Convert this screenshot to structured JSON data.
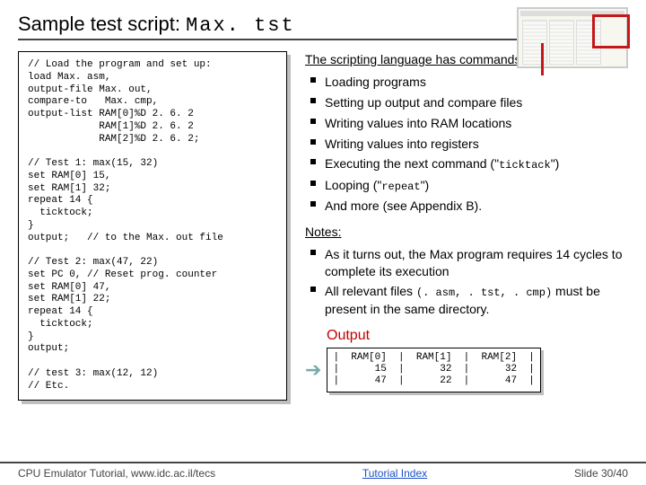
{
  "title_prefix": "Sample test script: ",
  "title_mono": "Max. tst",
  "code": "// Load the program and set up:\nload Max. asm,\noutput-file Max. out,\ncompare-to   Max. cmp,\noutput-list RAM[0]%D 2. 6. 2\n            RAM[1]%D 2. 6. 2\n            RAM[2]%D 2. 6. 2;\n\n// Test 1: max(15, 32)\nset RAM[0] 15,\nset RAM[1] 32;\nrepeat 14 {\n  ticktock;\n}\noutput;   // to the Max. out file\n\n// Test 2: max(47, 22)\nset PC 0, // Reset prog. counter\nset RAM[0] 47,\nset RAM[1] 22;\nrepeat 14 {\n  ticktock;\n}\noutput;\n\n// test 3: max(12, 12)\n// Etc.",
  "heading1": "The scripting language has commands for:",
  "bul": {
    "a": "Loading programs",
    "b": "Setting up output and compare files",
    "c": "Writing values into RAM locations",
    "d": "Writing values into registers",
    "e_pre": "Executing the next command (\"",
    "e_code": "ticktack",
    "e_post": "\")",
    "f_pre": "Looping (\"",
    "f_code": "repeat",
    "f_post": "\")",
    "g": "And more (see Appendix B)."
  },
  "notes_label": "Notes:",
  "note1": "As it turns out, the Max program requires 14 cycles to complete its execution",
  "note2_pre": "All relevant files ",
  "note2_code": "(. asm, . tst, . cmp)",
  "note2_post": " must be present in the same directory.",
  "output_label": "Output",
  "output_table": "|  RAM[0]  |  RAM[1]  |  RAM[2]  |\n|      15  |      32  |      32  |\n|      47  |      22  |      47  |",
  "footer_left": "CPU Emulator Tutorial, www.idc.ac.il/tecs",
  "footer_mid": "Tutorial Index",
  "footer_right": "Slide 30/40",
  "chart_data": {
    "type": "table",
    "title": "Output",
    "columns": [
      "RAM[0]",
      "RAM[1]",
      "RAM[2]"
    ],
    "rows": [
      [
        15,
        32,
        32
      ],
      [
        47,
        22,
        47
      ]
    ]
  }
}
